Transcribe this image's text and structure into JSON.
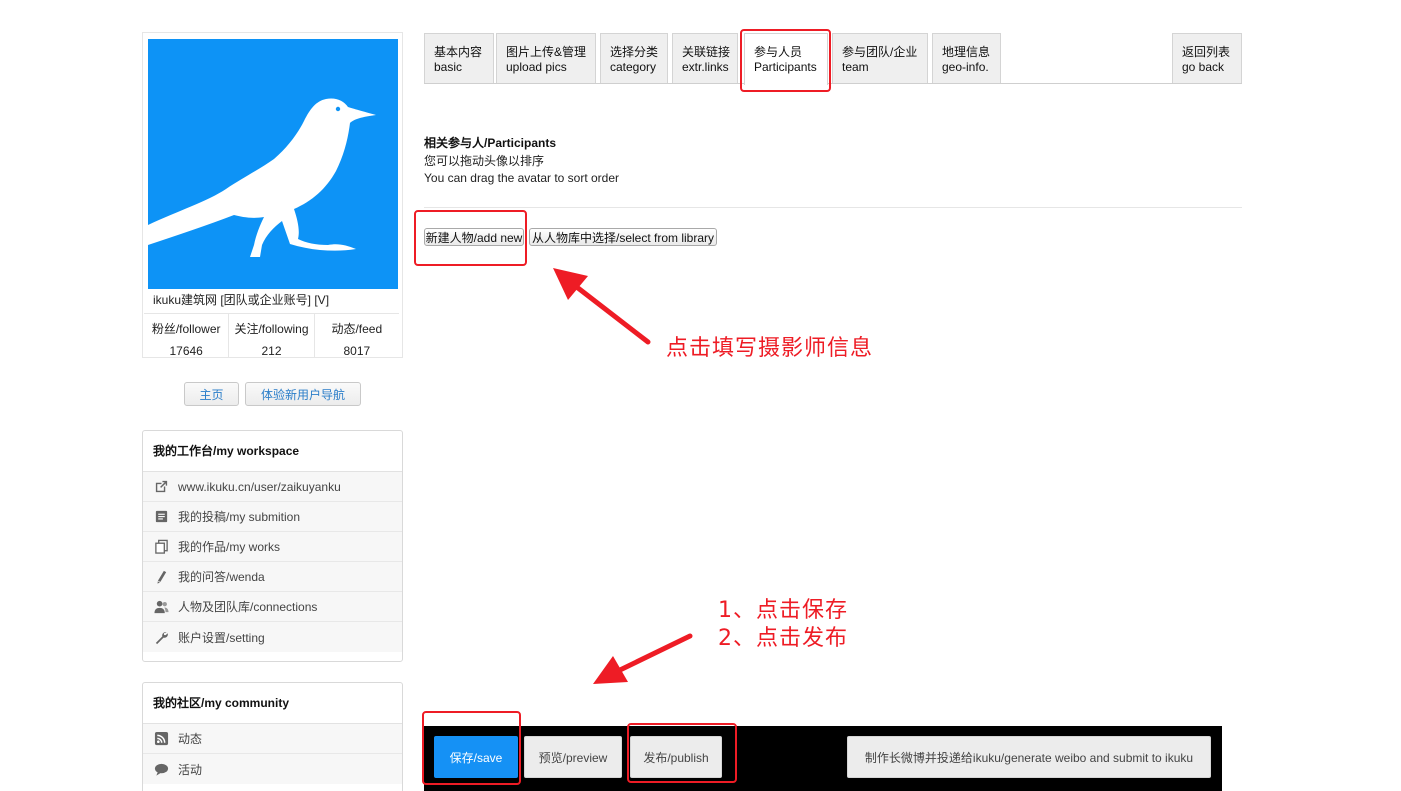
{
  "profile": {
    "name": "ikuku建筑网 [团队或企业账号] [V]",
    "stats": [
      {
        "label": "粉丝/follower",
        "value": "17646"
      },
      {
        "label": "关注/following",
        "value": "212"
      },
      {
        "label": "动态/feed",
        "value": "8017"
      }
    ],
    "buttons": {
      "home": "主页",
      "guide": "体验新用户导航"
    }
  },
  "workspace": {
    "title": "我的工作台/my workspace",
    "items": [
      {
        "icon": "external-link-icon",
        "label": "www.ikuku.cn/user/zaikuyanku"
      },
      {
        "icon": "document-icon",
        "label": "我的投稿/my submition"
      },
      {
        "icon": "copy-icon",
        "label": "我的作品/my works"
      },
      {
        "icon": "pencil-icon",
        "label": "我的问答/wenda"
      },
      {
        "icon": "people-icon",
        "label": "人物及团队库/connections"
      },
      {
        "icon": "wrench-icon",
        "label": "账户设置/setting"
      }
    ]
  },
  "community": {
    "title": "我的社区/my community",
    "items": [
      {
        "icon": "rss-icon",
        "label": "动态"
      },
      {
        "icon": "chat-icon",
        "label": "活动"
      }
    ]
  },
  "tabs": [
    {
      "line1": "基本内容",
      "line2": "basic"
    },
    {
      "line1": "图片上传&管理",
      "line2": "upload pics"
    },
    {
      "line1": "选择分类",
      "line2": "category"
    },
    {
      "line1": "关联链接",
      "line2": "extr.links"
    },
    {
      "line1": "参与人员",
      "line2": "Participants"
    },
    {
      "line1": "参与团队/企业",
      "line2": "team"
    },
    {
      "line1": "地理信息",
      "line2": "geo-info."
    },
    {
      "line1": "返回列表",
      "line2": "go back"
    }
  ],
  "participants": {
    "title": "相关参与人/Participants",
    "hint_cn": "您可以拖动头像以排序",
    "hint_en": "You can drag the avatar to sort order",
    "add_new": "新建人物/add new",
    "select_library": "从人物库中选择/select from library"
  },
  "actions": {
    "save": "保存/save",
    "preview": "预览/preview",
    "publish": "发布/publish",
    "weibo": "制作长微博并投递给ikuku/generate weibo and submit to ikuku"
  },
  "annotations": {
    "note1": "点击填写摄影师信息",
    "note2_line1": "1、点击保存",
    "note2_line2": "2、点击发布",
    "color": "#ee1c25"
  }
}
